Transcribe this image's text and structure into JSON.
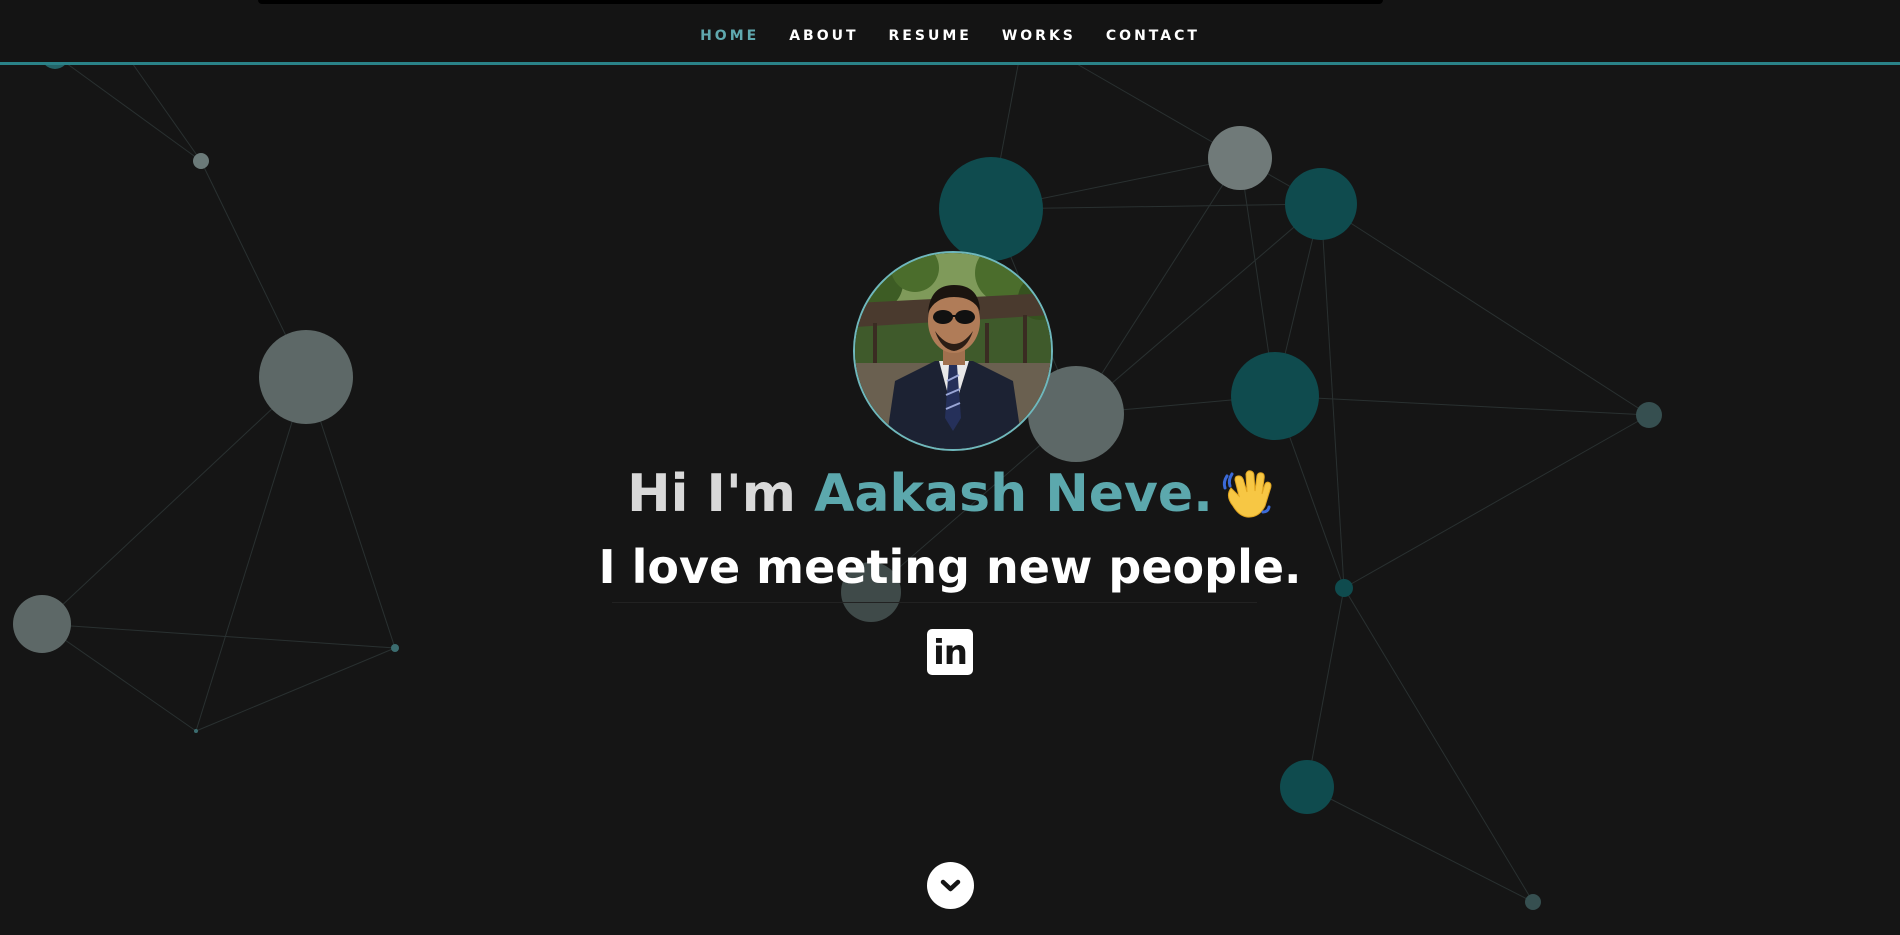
{
  "nav": {
    "items": [
      {
        "label": "HOME",
        "active": true
      },
      {
        "label": "ABOUT",
        "active": false
      },
      {
        "label": "RESUME",
        "active": false
      },
      {
        "label": "WORKS",
        "active": false
      },
      {
        "label": "CONTACT",
        "active": false
      }
    ]
  },
  "hero": {
    "greeting": "Hi I'm",
    "name": "Aakash Neve.",
    "wave_icon": "waving-hand-icon",
    "tagline": "I love meeting new people.",
    "social": {
      "linkedin_icon": "linkedin-icon",
      "linkedin_glyph": "in"
    },
    "scroll_icon": "chevron-down-icon"
  },
  "colors": {
    "background": "#151515",
    "accent": "#5ca8ad",
    "nav_border": "#2a8288",
    "text": "#ffffff",
    "headline_text": "#d9d9d9"
  }
}
